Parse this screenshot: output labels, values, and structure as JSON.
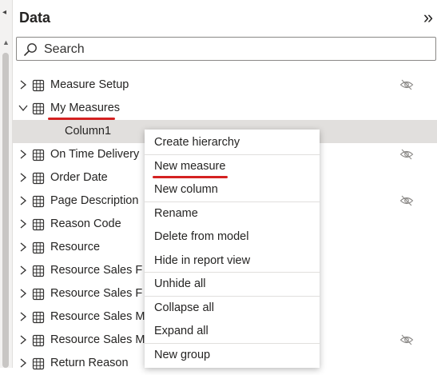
{
  "panel": {
    "title": "Data",
    "collapse_glyph": "»",
    "search": {
      "placeholder": "Search",
      "value": ""
    }
  },
  "tree": [
    {
      "label": "Measure Setup",
      "expanded": false,
      "hidden": true
    },
    {
      "label": "My Measures",
      "expanded": true,
      "hidden": false,
      "annotated": true
    },
    {
      "label": "Column1",
      "child": true
    },
    {
      "label": "On Time Delivery",
      "expanded": false,
      "hidden": true
    },
    {
      "label": "Order Date",
      "expanded": false,
      "hidden": false
    },
    {
      "label": "Page Description",
      "expanded": false,
      "hidden": true
    },
    {
      "label": "Reason Code",
      "expanded": false,
      "hidden": false
    },
    {
      "label": "Resource",
      "expanded": false,
      "hidden": false
    },
    {
      "label": "Resource Sales F",
      "expanded": false,
      "hidden": false
    },
    {
      "label": "Resource Sales F",
      "expanded": false,
      "hidden": false
    },
    {
      "label": "Resource Sales M",
      "expanded": false,
      "hidden": false
    },
    {
      "label": "Resource Sales M",
      "expanded": false,
      "hidden": true
    },
    {
      "label": "Return Reason",
      "expanded": false,
      "hidden": false
    }
  ],
  "context_menu": {
    "items": [
      {
        "label": "Create hierarchy"
      },
      {
        "label": "New measure",
        "annotated": true
      },
      {
        "label": "New column"
      },
      {
        "label": "Rename"
      },
      {
        "label": "Delete from model"
      },
      {
        "label": "Hide in report view"
      },
      {
        "label": "Unhide all"
      },
      {
        "label": "Collapse all"
      },
      {
        "label": "Expand all"
      },
      {
        "label": "New group"
      }
    ]
  },
  "colors": {
    "annotation": "#d42121",
    "selected_row": "#e1dfdd",
    "text": "#252423"
  }
}
